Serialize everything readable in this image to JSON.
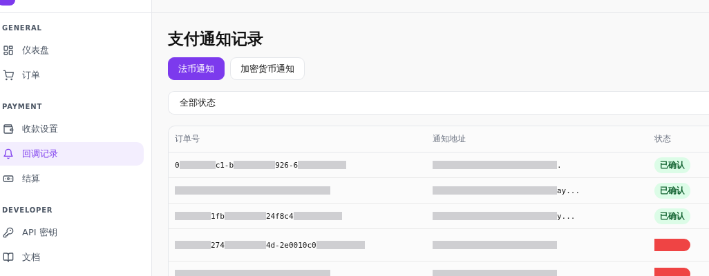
{
  "sidebar": {
    "sections": [
      {
        "title": "GENERAL",
        "items": [
          {
            "label": "仪表盘",
            "kind": "grid",
            "selected": false
          },
          {
            "label": "订单",
            "kind": "cart",
            "selected": false
          }
        ]
      },
      {
        "title": "PAYMENT",
        "items": [
          {
            "label": "收款设置",
            "kind": "wallet",
            "selected": false
          },
          {
            "label": "回调记录",
            "kind": "bell",
            "selected": true
          },
          {
            "label": "结算",
            "kind": "cash",
            "selected": false
          }
        ]
      },
      {
        "title": "DEVELOPER",
        "items": [
          {
            "label": "API 密钥",
            "kind": "key",
            "selected": false
          },
          {
            "label": "文档",
            "kind": "book",
            "selected": false
          }
        ]
      }
    ]
  },
  "page": {
    "title": "支付通知记录",
    "tabs": [
      {
        "label": "法币通知",
        "selected": true
      },
      {
        "label": "加密货币通知",
        "selected": false
      }
    ],
    "filter": {
      "value": "全部状态"
    },
    "table": {
      "columns": [
        "订单号",
        "通知地址",
        "状态"
      ],
      "rows": [
        {
          "order": [
            {
              "kind": "text",
              "text": "0"
            },
            {
              "kind": "masked"
            },
            {
              "kind": "text",
              "text": "c1-b"
            },
            {
              "kind": "masked"
            },
            {
              "kind": "text",
              "text": "926-6"
            },
            {
              "kind": "masked"
            }
          ],
          "url": [
            {
              "kind": "masked"
            },
            {
              "kind": "text",
              "text": "."
            }
          ],
          "status": {
            "kind": "confirmed",
            "text": "已确认"
          }
        },
        {
          "order": [
            {
              "kind": "masked"
            }
          ],
          "url": [
            {
              "kind": "masked"
            },
            {
              "kind": "text",
              "text": "ay..."
            }
          ],
          "status": {
            "kind": "confirmed",
            "text": "已确认"
          }
        },
        {
          "order": [
            {
              "kind": "masked"
            },
            {
              "kind": "text",
              "text": "1fb"
            },
            {
              "kind": "masked"
            },
            {
              "kind": "text",
              "text": "24f8c4"
            },
            {
              "kind": "masked"
            }
          ],
          "url": [
            {
              "kind": "masked"
            },
            {
              "kind": "text",
              "text": "y..."
            }
          ],
          "status": {
            "kind": "confirmed",
            "text": "已确认"
          }
        },
        {
          "order": [
            {
              "kind": "masked"
            },
            {
              "kind": "text",
              "text": "274"
            },
            {
              "kind": "masked"
            },
            {
              "kind": "text",
              "text": "4d-2e0010c0"
            },
            {
              "kind": "masked"
            }
          ],
          "url": [
            {
              "kind": "masked"
            }
          ],
          "status": {
            "kind": "masked",
            "color": "#ef4444"
          }
        },
        {
          "order": [
            {
              "kind": "masked"
            }
          ],
          "url": [
            {
              "kind": "masked"
            }
          ],
          "status": {
            "kind": "masked",
            "color": "#ef4444"
          }
        }
      ]
    }
  }
}
